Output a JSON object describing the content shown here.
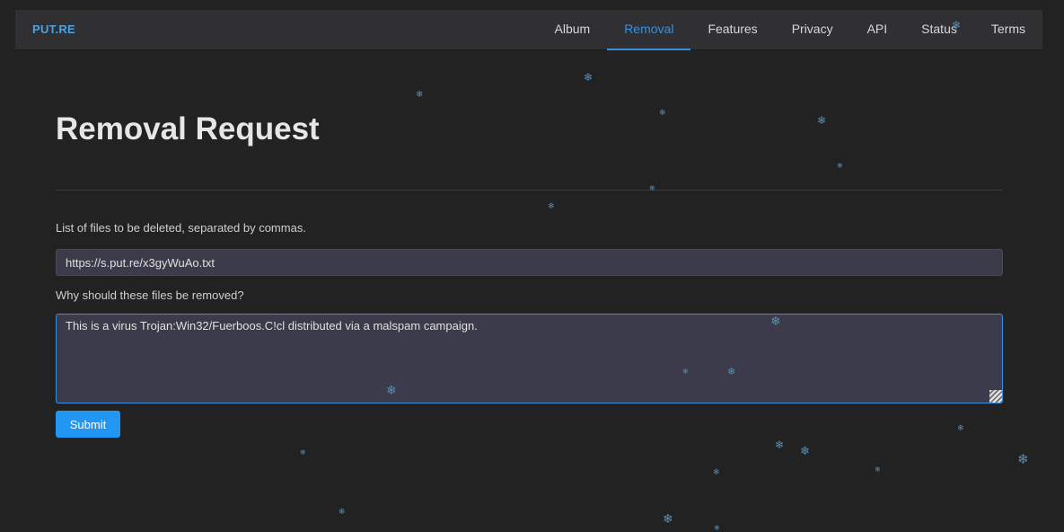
{
  "nav": {
    "brand": "PUT.RE",
    "items": [
      {
        "label": "Album",
        "active": false
      },
      {
        "label": "Removal",
        "active": true
      },
      {
        "label": "Features",
        "active": false
      },
      {
        "label": "Privacy",
        "active": false
      },
      {
        "label": "API",
        "active": false
      },
      {
        "label": "Status",
        "active": false
      },
      {
        "label": "Terms",
        "active": false
      }
    ]
  },
  "page": {
    "title": "Removal Request",
    "files_label": "List of files to be deleted, separated by commas.",
    "files_value": "https://s.put.re/x3gyWuAo.txt",
    "reason_label": "Why should these files be removed?",
    "reason_value": "This is a virus Trojan:Win32/Fuerboos.C!cl distributed via a malspam campaign.",
    "submit_label": "Submit"
  },
  "colors": {
    "accent": "#3a8ee0",
    "button": "#2196f3",
    "background": "#222222"
  },
  "decoration": {
    "snowflake_icon": "❄"
  }
}
